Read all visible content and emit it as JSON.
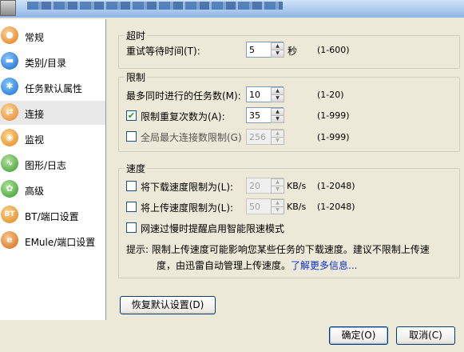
{
  "sidebar": {
    "items": [
      {
        "label": "常规",
        "icon": "general-icon"
      },
      {
        "label": "类别/目录",
        "icon": "folder-icon"
      },
      {
        "label": "任务默认属性",
        "icon": "star-icon"
      },
      {
        "label": "连接",
        "icon": "connection-icon"
      },
      {
        "label": "监视",
        "icon": "monitor-icon"
      },
      {
        "label": "图形/日志",
        "icon": "graph-icon"
      },
      {
        "label": "高级",
        "icon": "gear-icon"
      },
      {
        "label": "BT/端口设置",
        "icon": "bt-icon"
      },
      {
        "label": "EMule/端口设置",
        "icon": "emule-icon"
      }
    ],
    "selected": "连接"
  },
  "timeout": {
    "title": "超时",
    "retry_label": "重试等待时间(T):",
    "retry_value": "5",
    "retry_unit": "秒",
    "retry_range": "(1-600)"
  },
  "limits": {
    "title": "限制",
    "max_tasks_label": "最多同时进行的任务数(M):",
    "max_tasks_value": "10",
    "max_tasks_range": "(1-20)",
    "retry_limit_label": "限制重复次数为(A):",
    "retry_limit_checked": true,
    "retry_limit_value": "35",
    "retry_limit_range": "(1-999)",
    "global_conn_label": "全局最大连接数限制(G)",
    "global_conn_checked": false,
    "global_conn_value": "256",
    "global_conn_range": "(1-999)"
  },
  "speed": {
    "title": "速度",
    "download_label": "将下载速度限制为(L):",
    "download_value": "20",
    "download_unit": "KB/s",
    "download_range": "(1-2048)",
    "upload_label": "将上传速度限制为(L):",
    "upload_value": "50",
    "upload_unit": "KB/s",
    "upload_range": "(1-2048)",
    "smart_label": "网速过慢时提醒启用智能限速模式",
    "hint_line1": "提示: 限制上传速度可能影响您某些任务的下载速度。建议不限制上传速",
    "hint_line2": "度，由迅雷自动管理上传速度。",
    "hint_link": "了解更多信息..."
  },
  "restore_button": "恢复默认设置(D)",
  "ok_button": "确定(O)",
  "cancel_button": "取消(C)"
}
